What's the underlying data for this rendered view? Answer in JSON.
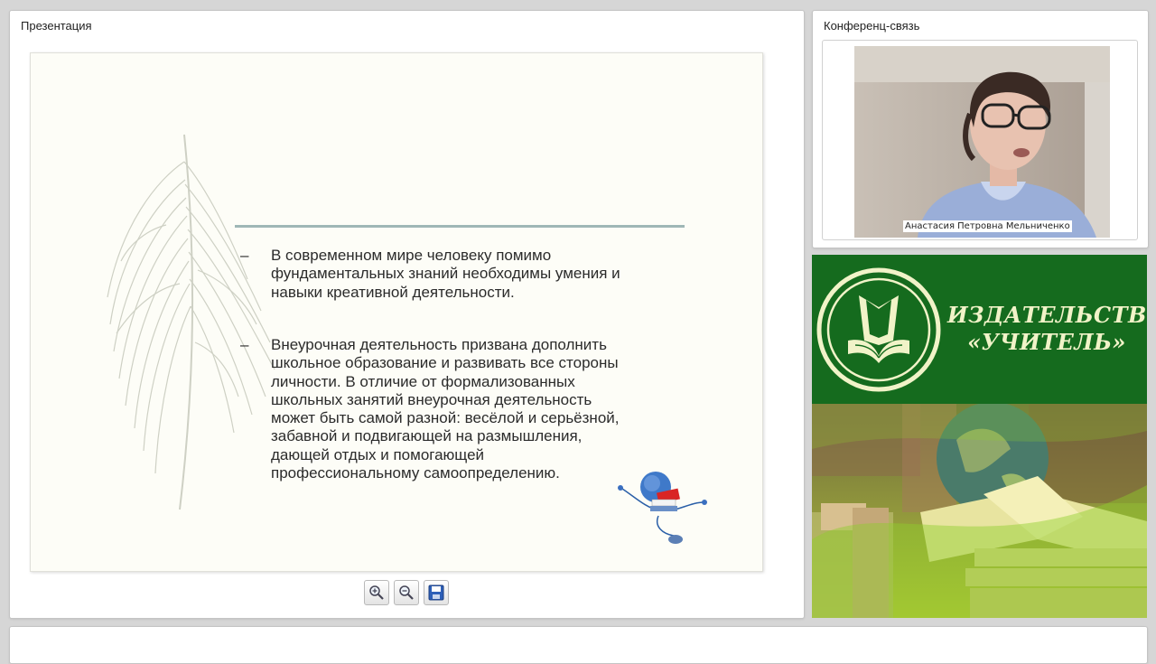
{
  "presentation": {
    "title": "Презентация",
    "slide": {
      "bullets": [
        {
          "dash": "–",
          "text": "В современном мире человеку помимо\nфундаментальных знаний необходимы умения и\nнавыки креативной деятельности."
        },
        {
          "dash": "–",
          "text": "Внеурочная деятельность призвана дополнить\nшкольное образование и развивать все стороны\nличности. В отличие от формализованных\nшкольных занятий внеурочная деятельность\nможет быть самой разной: весёлой и серьёзной,\nзабавной и подвигающей на размышления,\nдающей отдых и помогающей\nпрофессиональному самоопределению."
        }
      ]
    },
    "toolbar": {
      "zoom_in": "zoom-in-icon",
      "zoom_out": "zoom-out-icon",
      "save": "save-icon"
    }
  },
  "conference": {
    "title": "Конференц-связь",
    "participant_name": "Анастасия Петровна Мельниченко"
  },
  "banner": {
    "publisher_line1": "ИЗДАТЕЛЬСТВО",
    "publisher_line2": "«УЧИТЕЛЬ»",
    "colors": {
      "green": "#156b1e",
      "cream": "#f1f3c8",
      "photo_tint": "#8fcf2a"
    }
  }
}
